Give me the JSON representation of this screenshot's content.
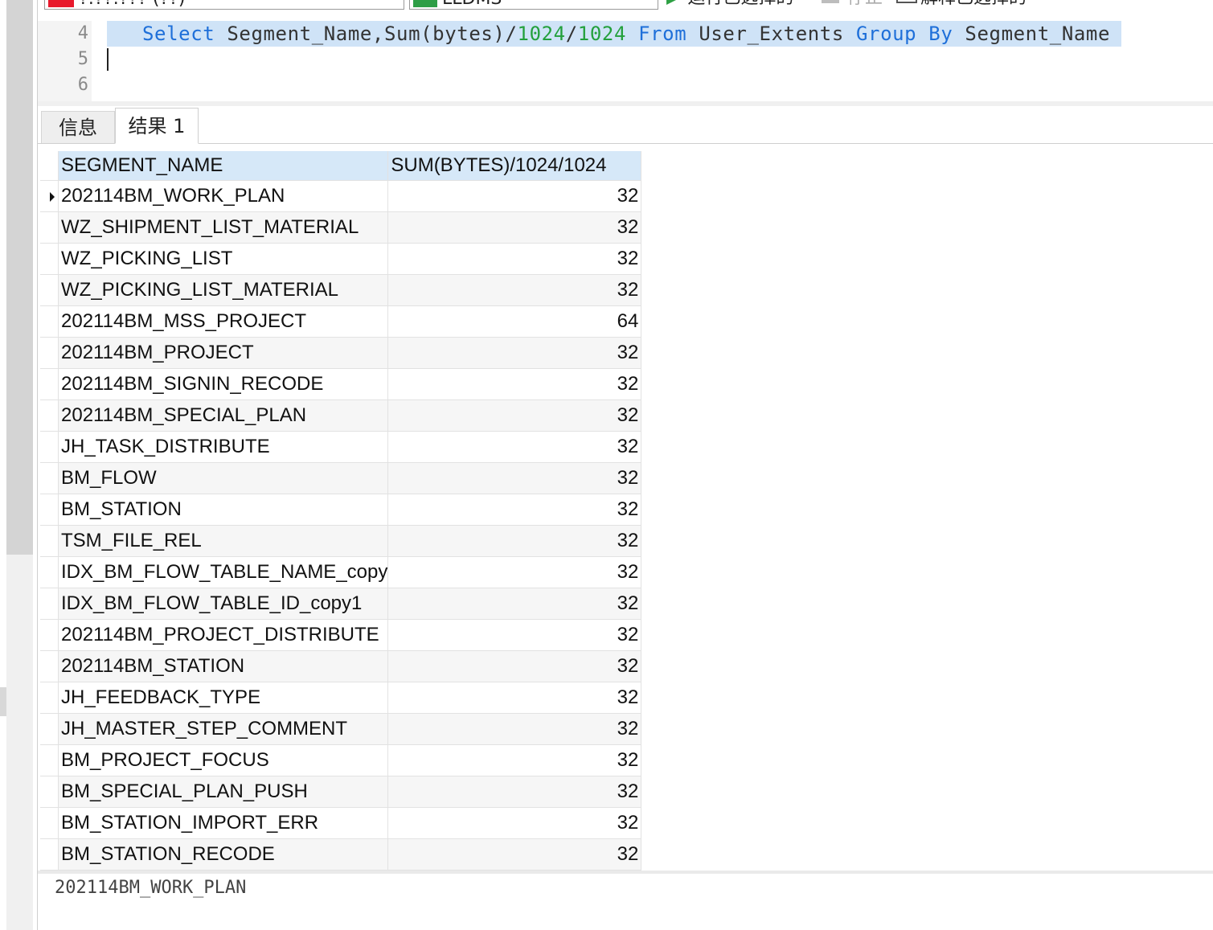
{
  "toolbar": {
    "connection": "?:??:??? (??)",
    "database": "LLDMS",
    "run_selected_label": "运行已选择的",
    "stop_label": "停止",
    "explain_label": "解释已选择的"
  },
  "editor": {
    "line_numbers": [
      "4",
      "5",
      "6"
    ],
    "line4": {
      "t1": "Select",
      "t2": " Segment_Name,Sum(bytes)/",
      "t3": "1024",
      "t4": "/",
      "t5": "1024",
      "t6": " ",
      "t7": "From",
      "t8": " User_Extents ",
      "t9": "Group By",
      "t10": " Segment_Name"
    }
  },
  "tabs": {
    "info_label": "信息",
    "result_label": "结果 1"
  },
  "grid": {
    "columns": [
      "SEGMENT_NAME",
      "SUM(BYTES)/1024/1024"
    ],
    "rows": [
      {
        "name": "202114BM_WORK_PLAN",
        "value": "32"
      },
      {
        "name": "WZ_SHIPMENT_LIST_MATERIAL",
        "value": "32"
      },
      {
        "name": "WZ_PICKING_LIST",
        "value": "32"
      },
      {
        "name": "WZ_PICKING_LIST_MATERIAL",
        "value": "32"
      },
      {
        "name": "202114BM_MSS_PROJECT",
        "value": "64"
      },
      {
        "name": "202114BM_PROJECT",
        "value": "32"
      },
      {
        "name": "202114BM_SIGNIN_RECODE",
        "value": "32"
      },
      {
        "name": "202114BM_SPECIAL_PLAN",
        "value": "32"
      },
      {
        "name": "JH_TASK_DISTRIBUTE",
        "value": "32"
      },
      {
        "name": "BM_FLOW",
        "value": "32"
      },
      {
        "name": "BM_STATION",
        "value": "32"
      },
      {
        "name": "TSM_FILE_REL",
        "value": "32"
      },
      {
        "name": "IDX_BM_FLOW_TABLE_NAME_copy",
        "value": "32"
      },
      {
        "name": "IDX_BM_FLOW_TABLE_ID_copy1",
        "value": "32"
      },
      {
        "name": "202114BM_PROJECT_DISTRIBUTE",
        "value": "32"
      },
      {
        "name": "202114BM_STATION",
        "value": "32"
      },
      {
        "name": "JH_FEEDBACK_TYPE",
        "value": "32"
      },
      {
        "name": "JH_MASTER_STEP_COMMENT",
        "value": "32"
      },
      {
        "name": "BM_PROJECT_FOCUS",
        "value": "32"
      },
      {
        "name": "BM_SPECIAL_PLAN_PUSH",
        "value": "32"
      },
      {
        "name": "BM_STATION_IMPORT_ERR",
        "value": "32"
      },
      {
        "name": "BM_STATION_RECODE",
        "value": "32"
      }
    ],
    "selected_row": 0
  },
  "status": {
    "selected_value": "202114BM_WORK_PLAN"
  }
}
